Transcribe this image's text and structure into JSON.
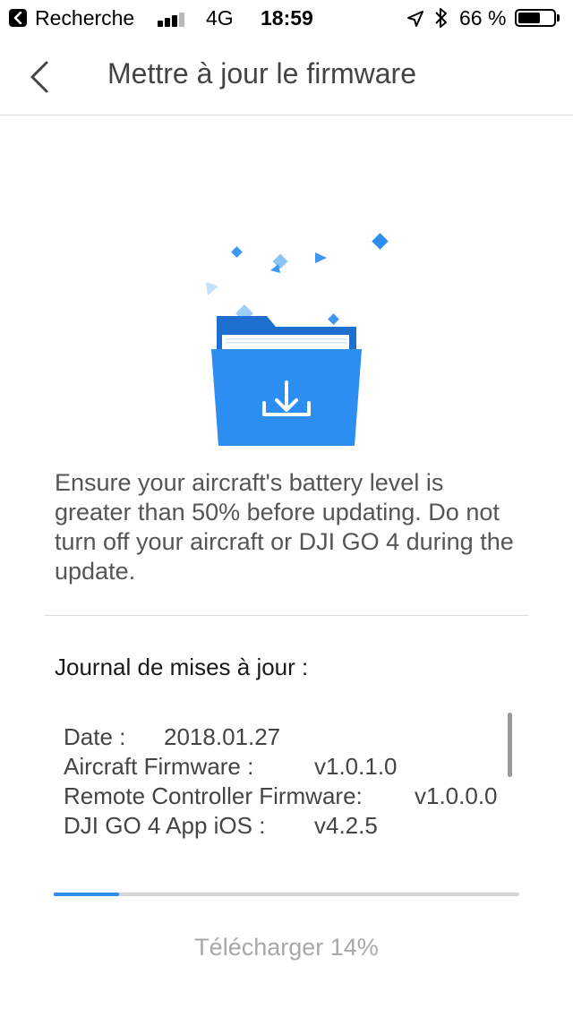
{
  "status_bar": {
    "back_app_label": "Recherche",
    "network": "4G",
    "time": "18:59",
    "battery_percent_text": "66 %",
    "battery_level": 0.66,
    "signal_bars_filled": 3,
    "signal_bars_total": 4
  },
  "nav": {
    "back_icon": "chevron-left-icon",
    "title": "Mettre à jour le firmware"
  },
  "illustration": {
    "icon": "folder-download-icon",
    "accent_color": "#2b8ef0"
  },
  "notice": "Ensure your aircraft's battery level is greater than 50% before updating. Do not turn off your aircraft or DJI GO 4 during the update.",
  "changelog": {
    "title": "Journal de mises à jour :",
    "rows": [
      {
        "key": "Date :",
        "value": "2018.01.27"
      },
      {
        "key": "Aircraft Firmware :",
        "value": "v1.0.1.0"
      },
      {
        "key": "Remote Controller Firmware:",
        "value": "v1.0.0.0"
      },
      {
        "key": "DJI GO 4 App iOS :",
        "value": "v4.2.5"
      }
    ]
  },
  "download": {
    "label": "Télécharger 14%",
    "progress": 0.14,
    "progress_color": "#2b8ef0"
  }
}
